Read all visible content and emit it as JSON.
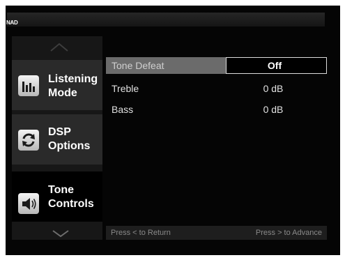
{
  "header": {
    "brand": "NAD"
  },
  "sidebar": {
    "items": [
      {
        "label": "Listening\nMode",
        "icon": "equalizer-icon"
      },
      {
        "label": "DSP\nOptions",
        "icon": "refresh-cycle-icon"
      },
      {
        "label": "Tone\nControls",
        "icon": "speaker-icon"
      }
    ],
    "selected_index": 2
  },
  "settings": {
    "rows": [
      {
        "label": "Tone Defeat",
        "value": "Off"
      },
      {
        "label": "Treble",
        "value": "0 dB"
      },
      {
        "label": "Bass",
        "value": "0 dB"
      }
    ]
  },
  "footer": {
    "return_hint": "Press < to Return",
    "advance_hint": "Press > to Advance"
  }
}
